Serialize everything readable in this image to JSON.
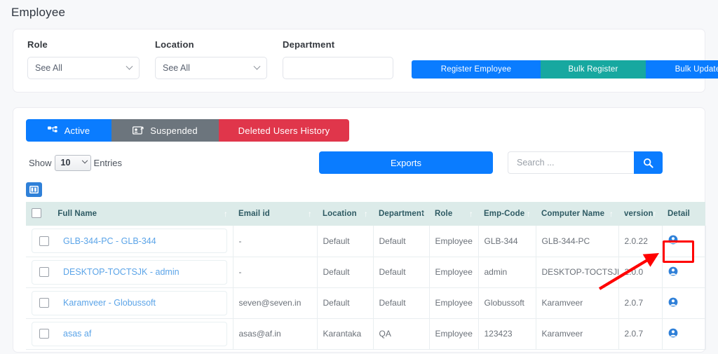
{
  "header": {
    "title": "Employee"
  },
  "filters": {
    "role": {
      "label": "Role",
      "value": "See All"
    },
    "location": {
      "label": "Location",
      "value": "See All"
    },
    "department": {
      "label": "Department",
      "value": ""
    }
  },
  "actions": {
    "register_employee": "Register Employee",
    "bulk_register": "Bulk Register",
    "bulk_update": "Bulk Update"
  },
  "tabs": [
    {
      "label": "Active",
      "icon": "sitemap-icon",
      "state": "active"
    },
    {
      "label": "Suspended",
      "icon": "user-card-icon",
      "state": "inactive"
    },
    {
      "label": "Deleted Users History",
      "icon": "none",
      "state": "inactive"
    }
  ],
  "controls": {
    "show_label": "Show",
    "entries_value": "10",
    "entries_label": "Entries",
    "exports_label": "Exports",
    "search_placeholder": "Search ...",
    "search_value": "",
    "search_icon": "search-icon",
    "column_picker_icon": "columns-icon"
  },
  "table": {
    "columns": [
      "Full Name",
      "Email id",
      "Location",
      "Department",
      "Role",
      "Emp-Code",
      "Computer Name",
      "version",
      "Detail"
    ],
    "rows": [
      {
        "full_name": "GLB-344-PC - GLB-344",
        "email": "-",
        "location": "Default",
        "department": "Default",
        "role": "Employee",
        "emp_code": "GLB-344",
        "computer_name": "GLB-344-PC",
        "version": "2.0.22",
        "detail_icon": "user-circle-icon"
      },
      {
        "full_name": "DESKTOP-TOCTSJK - admin",
        "email": "-",
        "location": "Default",
        "department": "Default",
        "role": "Employee",
        "emp_code": "admin",
        "computer_name": "DESKTOP-TOCTSJK",
        "version": "2.0.0",
        "detail_icon": "user-circle-icon"
      },
      {
        "full_name": "Karamveer - Globussoft",
        "email": "seven@seven.in",
        "location": "Default",
        "department": "Default",
        "role": "Employee",
        "emp_code": "Globussoft",
        "computer_name": "Karamveer",
        "version": "2.0.7",
        "detail_icon": "user-circle-icon"
      },
      {
        "full_name": "asas af",
        "email": "asas@af.in",
        "location": "Karantaka",
        "department": "QA",
        "role": "Employee",
        "emp_code": "123423",
        "computer_name": "Karamveer",
        "version": "2.0.7",
        "detail_icon": "user-circle-icon"
      }
    ]
  },
  "colors": {
    "primary_blue": "#0a7cff",
    "teal": "#17a8a0",
    "red": "#e0364b",
    "gray": "#6c757d",
    "header_teal_bg": "#dcebe9",
    "header_teal_text": "#2e5a63",
    "link_blue": "#5ba4e8",
    "annotation_red": "#ff0000"
  }
}
